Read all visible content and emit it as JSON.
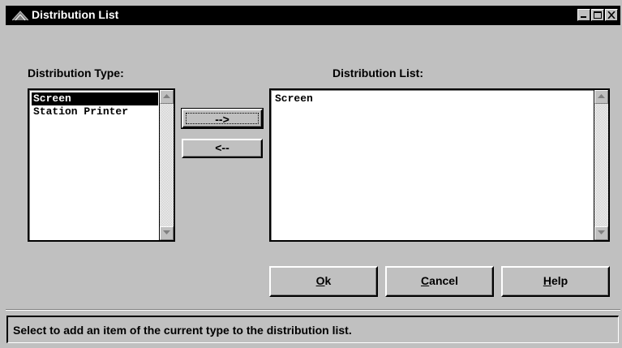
{
  "window": {
    "title": "Distribution List",
    "icon": "distribution-list-app-icon",
    "controls": [
      "minimize-icon",
      "maximize-icon",
      "close-icon"
    ]
  },
  "distribution_type": {
    "label": "Distribution Type:",
    "items": [
      {
        "label": "Screen",
        "selected": true
      },
      {
        "label": "Station Printer",
        "selected": false
      }
    ]
  },
  "distribution_list": {
    "label": "Distribution List:",
    "items": [
      {
        "label": "Screen",
        "selected": false
      }
    ]
  },
  "buttons": {
    "add": "-->",
    "remove": "<--",
    "ok": "Ok",
    "cancel": "Cancel",
    "help": "Help"
  },
  "status": "Select to add an item of the current type to the distribution list."
}
